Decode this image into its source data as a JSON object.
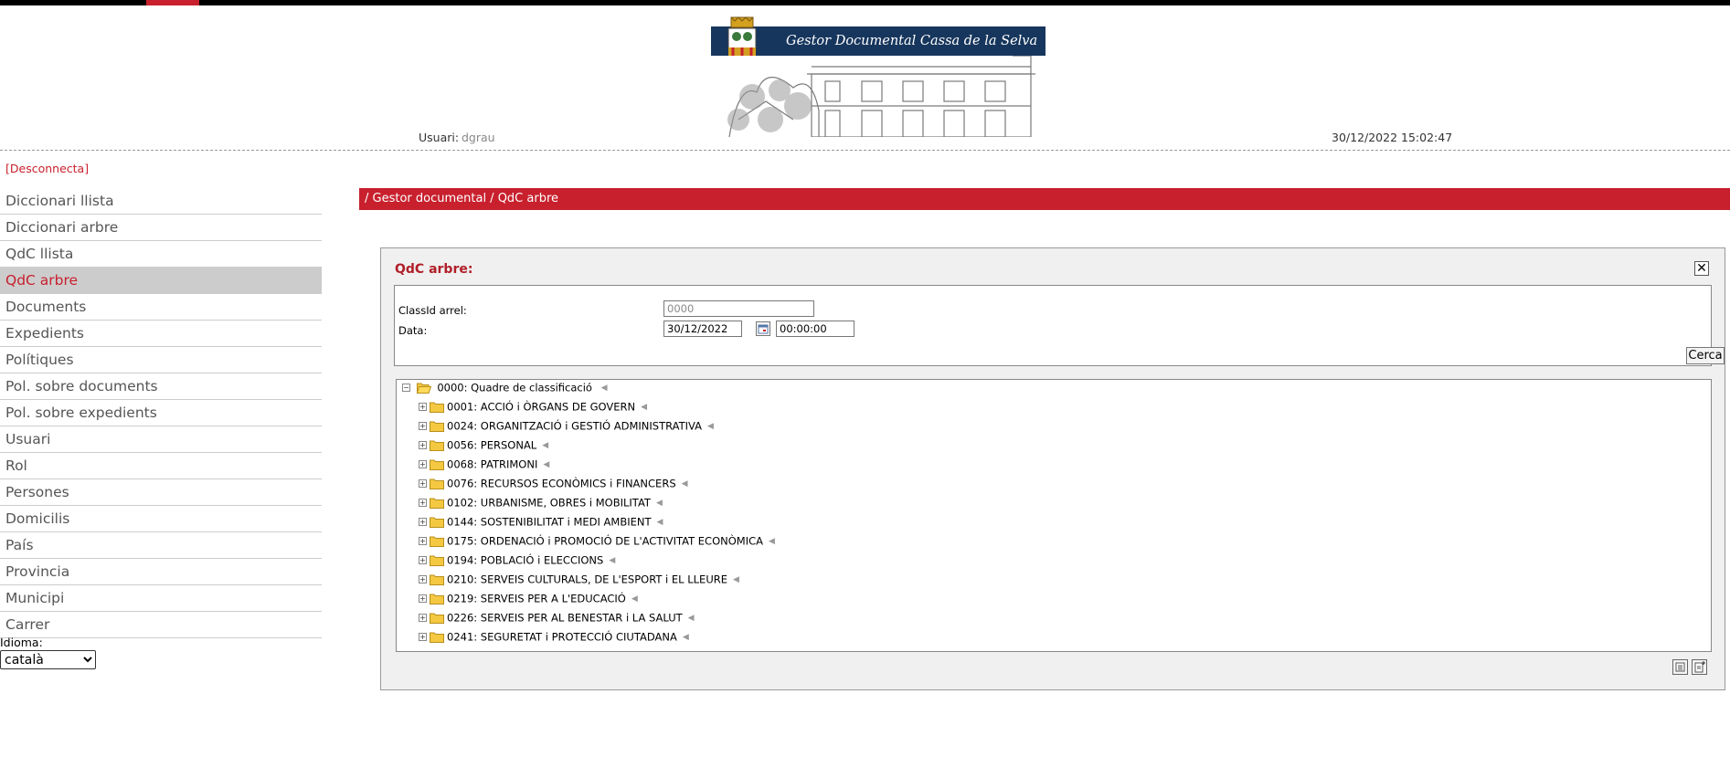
{
  "header": {
    "banner_title": "Gestor Documental Cassa de la Selva",
    "user_label": "Usuari:",
    "user_value": "dgrau",
    "datetime": "30/12/2022 15:02:47"
  },
  "sidebar": {
    "logout": "[Desconnecta]",
    "items": [
      {
        "label": "Diccionari llista"
      },
      {
        "label": "Diccionari arbre"
      },
      {
        "label": "QdC llista"
      },
      {
        "label": "QdC arbre"
      },
      {
        "label": "Documents"
      },
      {
        "label": "Expedients"
      },
      {
        "label": "Polítiques"
      },
      {
        "label": "Pol. sobre documents"
      },
      {
        "label": "Pol. sobre expedients"
      },
      {
        "label": "Usuari"
      },
      {
        "label": "Rol"
      },
      {
        "label": "Persones"
      },
      {
        "label": "Domicilis"
      },
      {
        "label": "País"
      },
      {
        "label": "Provincia"
      },
      {
        "label": "Municipi"
      },
      {
        "label": "Carrer"
      }
    ],
    "active_index": 3,
    "language_label": "Idioma:",
    "language_value": "català"
  },
  "breadcrumb": "/ Gestor documental / QdC arbre",
  "panel": {
    "title": "QdC arbre:",
    "close": "✕",
    "form": {
      "classid_label": "ClassId arrel:",
      "classid_value": "0000",
      "date_label": "Data:",
      "date_value": "30/12/2022",
      "time_value": "00:00:00",
      "search_label": "Cerca"
    },
    "tree": {
      "root": "0000: Quadre de classificació",
      "children": [
        "0001: ACCIÓ i ÒRGANS DE GOVERN",
        "0024: ORGANITZACIÓ i GESTIÓ ADMINISTRATIVA",
        "0056: PERSONAL",
        "0068: PATRIMONI",
        "0076: RECURSOS ECONÒMICS i FINANCERS",
        "0102: URBANISME, OBRES i MOBILITAT",
        "0144: SOSTENIBILITAT i MEDI AMBIENT",
        "0175: ORDENACIÓ i PROMOCIÓ DE L'ACTIVITAT ECONÒMICA",
        "0194: POBLACIÓ i ELECCIONS",
        "0210: SERVEIS CULTURALS, DE L'ESPORT i EL LLEURE",
        "0219: SERVEIS PER A L'EDUCACIÓ",
        "0226: SERVEIS PER AL BENESTAR i LA SALUT",
        "0241: SEGURETAT i PROTECCIÓ CIUTADANA"
      ]
    }
  },
  "colors": {
    "accent": "#c8202d",
    "banner": "#17365d",
    "active_bg": "#cccccc"
  }
}
